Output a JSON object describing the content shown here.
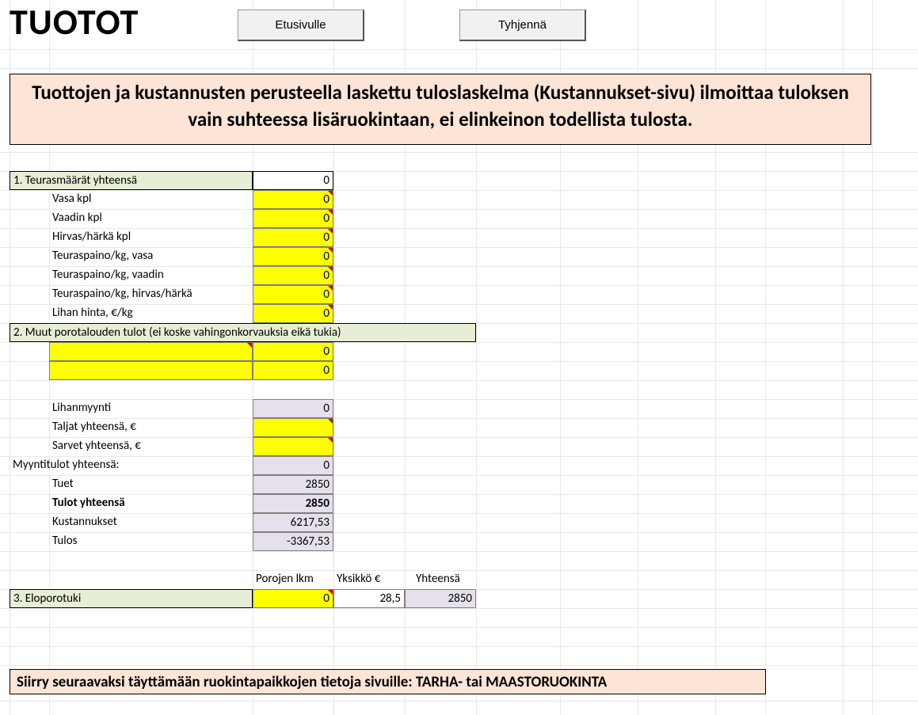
{
  "title": "TUOTOT",
  "buttons": {
    "home": "Etusivulle",
    "clear": "Tyhjennä"
  },
  "banner": "Tuottojen ja kustannusten perusteella laskettu tuloslaskelma (Kustannukset-sivu) ilmoittaa tuloksen vain suhteessa lisäruokintaan, ei elinkeinon todellista tulosta.",
  "section1": {
    "header": "1. Teurasmäärät yhteensä",
    "total": "0",
    "rows": [
      {
        "label": "Vasa kpl",
        "value": "0"
      },
      {
        "label": "Vaadin kpl",
        "value": "0"
      },
      {
        "label": "Hirvas/härkä kpl",
        "value": "0"
      },
      {
        "label": "Teuraspaino/kg, vasa",
        "value": "0"
      },
      {
        "label": "Teuraspaino/kg, vaadin",
        "value": "0"
      },
      {
        "label": "Teuraspaino/kg, hirvas/härkä",
        "value": "0"
      },
      {
        "label": "Lihan hinta, €/kg",
        "value": "0"
      }
    ]
  },
  "section2": {
    "header": "2. Muut porotalouden tulot  (ei koske vahingonkorvauksia eikä tukia)",
    "rows": [
      {
        "label": "",
        "value": "0"
      },
      {
        "label": "",
        "value": "0"
      }
    ]
  },
  "sales": {
    "lihanmyynti_label": "Lihanmyynti",
    "lihanmyynti_value": "0",
    "taljat_label": "Taljat yhteensä, €",
    "sarvet_label": "Sarvet yhteensä, €",
    "total_label": "Myyntitulot yhteensä:",
    "total_value": "0",
    "tuet_label": "Tuet",
    "tuet_value": "2850",
    "tulot_label": "Tulot yhteensä",
    "tulot_value": "2850",
    "kust_label": "Kustannukset",
    "kust_value": "6217,53",
    "tulos_label": "Tulos",
    "tulos_value": "-3367,53"
  },
  "section3": {
    "col_headers": {
      "a": "Porojen lkm",
      "b": "Yksikkö €",
      "c": "Yhteensä"
    },
    "header": "3. Eloporotuki",
    "lkm": "0",
    "yksikko": "28,5",
    "yhteensa": "2850"
  },
  "footer": "Siirry seuraavaksi täyttämään ruokintapaikkojen tietoja sivuille: TARHA- tai MAASTORUOKINTA"
}
